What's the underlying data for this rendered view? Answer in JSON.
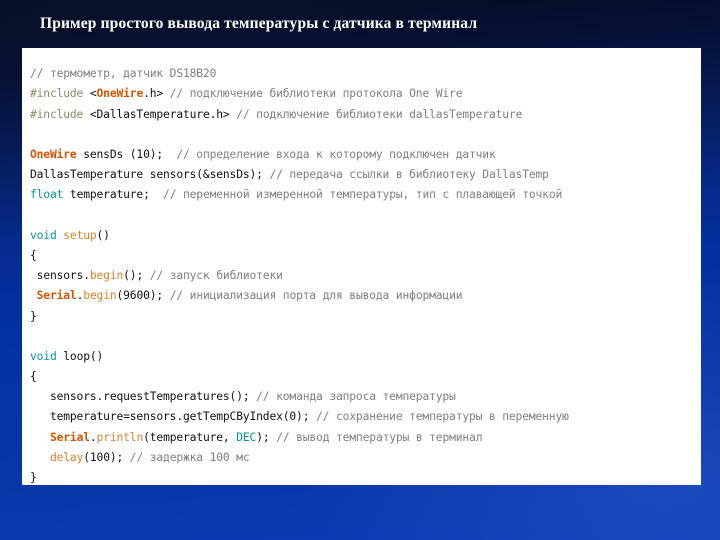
{
  "slide": {
    "title": "Пример простого вывода температуры с датчика в терминал",
    "background_top_color": "#05091d",
    "background_bottom_color": "#0c3cb2",
    "panel_color": "#ffffff"
  },
  "syntax_colors": {
    "comment": "#7f7f7f",
    "preprocessor": "#8a8a6a",
    "type_keyword": "#00979c",
    "library": "#d35400",
    "function": "#d9822b",
    "plain": "#111111"
  },
  "code": {
    "language": "Arduino C++",
    "lines": [
      {
        "id": "l01",
        "tokens": [
          {
            "t": "// термометр, датчик DS18B20",
            "c": "t-com"
          }
        ]
      },
      {
        "id": "l02",
        "tokens": [
          {
            "t": "#include ",
            "c": "t-pre"
          },
          {
            "t": "<",
            "c": "t-plain"
          },
          {
            "t": "OneWire",
            "c": "t-lib"
          },
          {
            "t": ".h> ",
            "c": "t-plain"
          },
          {
            "t": "// подключение библиотеки протокола One Wire",
            "c": "t-com"
          }
        ]
      },
      {
        "id": "l03",
        "tokens": [
          {
            "t": "#include ",
            "c": "t-pre"
          },
          {
            "t": "<DallasTemperature.h> ",
            "c": "t-plain"
          },
          {
            "t": "// подключение библиотеки dallasTemperature",
            "c": "t-com"
          }
        ]
      },
      {
        "id": "l04",
        "tokens": []
      },
      {
        "id": "l05",
        "tokens": [
          {
            "t": "OneWire",
            "c": "t-lib"
          },
          {
            "t": " sensDs (10);  ",
            "c": "t-plain"
          },
          {
            "t": "// определение входа к которому подключен датчик",
            "c": "t-com"
          }
        ]
      },
      {
        "id": "l06",
        "tokens": [
          {
            "t": "DallasTemperature sensors(&sensDs); ",
            "c": "t-plain"
          },
          {
            "t": "// передача ссылки в библиотеку DallasTemp",
            "c": "t-com"
          }
        ]
      },
      {
        "id": "l07",
        "tokens": [
          {
            "t": "float",
            "c": "t-type"
          },
          {
            "t": " temperature;  ",
            "c": "t-plain"
          },
          {
            "t": "// переменной измеренной температуры, тип с плавающей точкой",
            "c": "t-com"
          }
        ]
      },
      {
        "id": "l08",
        "tokens": []
      },
      {
        "id": "l09",
        "tokens": [
          {
            "t": "void",
            "c": "t-type"
          },
          {
            "t": " ",
            "c": "t-plain"
          },
          {
            "t": "setup",
            "c": "t-fn"
          },
          {
            "t": "()",
            "c": "t-plain"
          }
        ]
      },
      {
        "id": "l10",
        "tokens": [
          {
            "t": "{",
            "c": "t-plain"
          }
        ]
      },
      {
        "id": "l11",
        "tokens": [
          {
            "t": " sensors.",
            "c": "t-plain"
          },
          {
            "t": "begin",
            "c": "t-fn"
          },
          {
            "t": "(); ",
            "c": "t-plain"
          },
          {
            "t": "// запуск библиотеки",
            "c": "t-com"
          }
        ]
      },
      {
        "id": "l12",
        "tokens": [
          {
            "t": " ",
            "c": "t-plain"
          },
          {
            "t": "Serial",
            "c": "t-lib"
          },
          {
            "t": ".",
            "c": "t-plain"
          },
          {
            "t": "begin",
            "c": "t-fn"
          },
          {
            "t": "(9600); ",
            "c": "t-plain"
          },
          {
            "t": "// инициализация порта для вывода информации",
            "c": "t-com"
          }
        ]
      },
      {
        "id": "l13",
        "tokens": [
          {
            "t": "}",
            "c": "t-plain"
          }
        ]
      },
      {
        "id": "l14",
        "tokens": []
      },
      {
        "id": "l15",
        "tokens": [
          {
            "t": "void",
            "c": "t-type"
          },
          {
            "t": " loop()",
            "c": "t-plain"
          }
        ]
      },
      {
        "id": "l16",
        "tokens": [
          {
            "t": "{",
            "c": "t-plain"
          }
        ]
      },
      {
        "id": "l17",
        "tokens": [
          {
            "t": "   sensors.requestTemperatures(); ",
            "c": "t-plain"
          },
          {
            "t": "// команда запроса температуры",
            "c": "t-com"
          }
        ]
      },
      {
        "id": "l18",
        "tokens": [
          {
            "t": "   temperature=sensors.getTempCByIndex(0); ",
            "c": "t-plain"
          },
          {
            "t": "// сохранение температуры в переменную",
            "c": "t-com"
          }
        ]
      },
      {
        "id": "l19",
        "tokens": [
          {
            "t": "   ",
            "c": "t-plain"
          },
          {
            "t": "Serial",
            "c": "t-lib"
          },
          {
            "t": ".",
            "c": "t-plain"
          },
          {
            "t": "println",
            "c": "t-fn"
          },
          {
            "t": "(temperature, ",
            "c": "t-plain"
          },
          {
            "t": "DEC",
            "c": "t-type"
          },
          {
            "t": "); ",
            "c": "t-plain"
          },
          {
            "t": "// вывод температуры в терминал",
            "c": "t-com"
          }
        ]
      },
      {
        "id": "l20",
        "tokens": [
          {
            "t": "   ",
            "c": "t-plain"
          },
          {
            "t": "delay",
            "c": "t-fn"
          },
          {
            "t": "(100); ",
            "c": "t-plain"
          },
          {
            "t": "// задержка 100 мс",
            "c": "t-com"
          }
        ]
      },
      {
        "id": "l21",
        "tokens": [
          {
            "t": "}",
            "c": "t-plain"
          }
        ]
      }
    ]
  }
}
